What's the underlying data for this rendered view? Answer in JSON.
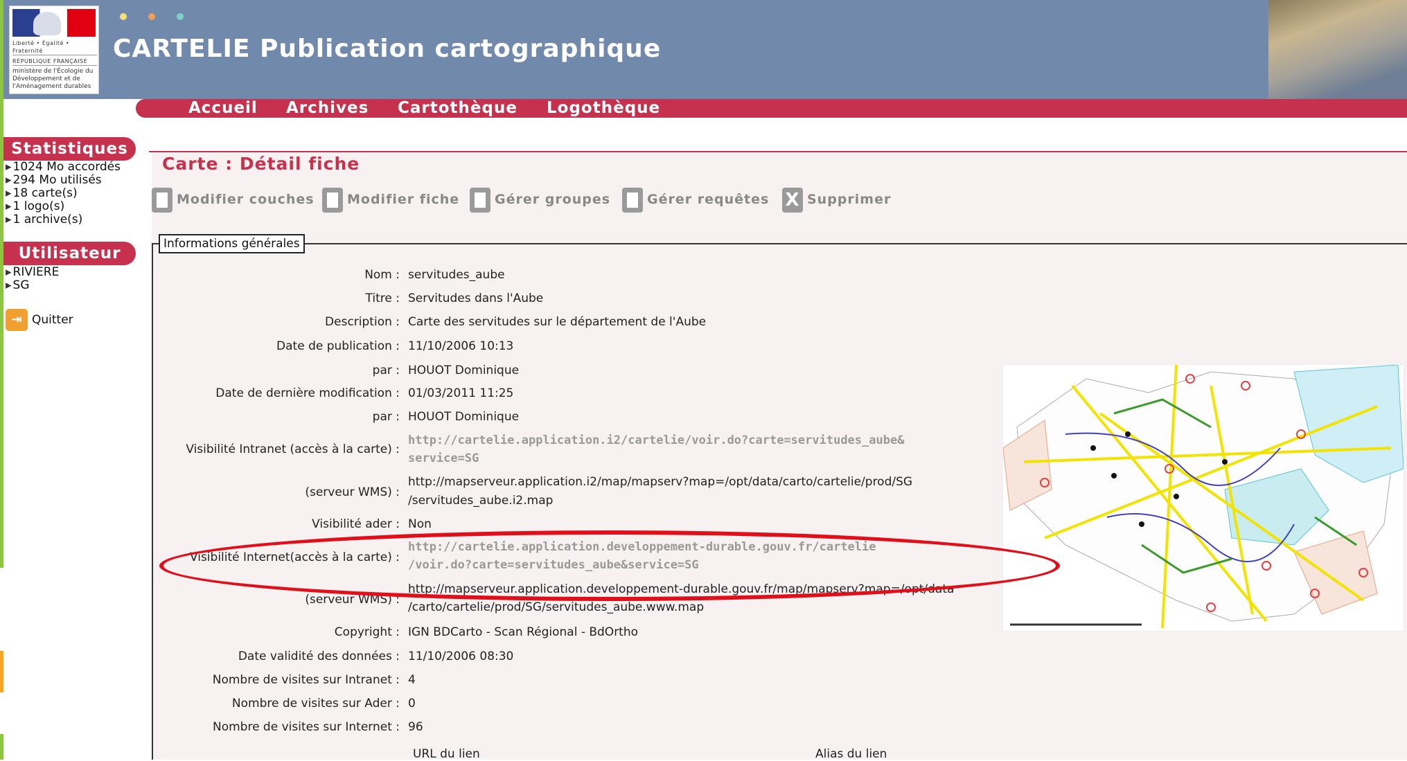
{
  "header": {
    "title": "CARTELIE Publication cartographique",
    "logo": {
      "motto": "Liberté • Égalité • Fraternité",
      "republic": "RÉPUBLIQUE FRANÇAISE",
      "ministry": "ministère de l'Écologie du Développement et de l'Aménagement durables"
    },
    "dot_colors": [
      "#f2e27a",
      "#f0a05a",
      "#7fd1c7"
    ]
  },
  "nav": {
    "items": [
      "Accueil",
      "Archives",
      "Cartothèque",
      "Logothèque"
    ]
  },
  "sidebar": {
    "stats_title": "Statistiques",
    "stats": [
      "1024 Mo accordés",
      "294 Mo utilisés",
      "18 carte(s)",
      "1 logo(s)",
      "1 archive(s)"
    ],
    "user_title": "Utilisateur",
    "user": [
      "RIVIERE",
      "SG"
    ],
    "quit_label": "Quitter"
  },
  "page": {
    "title": "Carte : Détail fiche",
    "toolbar": [
      "Modifier couches",
      "Modifier fiche",
      "Gérer groupes",
      "Gérer requêtes",
      "Supprimer"
    ],
    "legend": "Informations générales"
  },
  "fields": [
    {
      "label": "Nom :",
      "value": "servitudes_aube"
    },
    {
      "label": "Titre :",
      "value": "Servitudes dans l'Aube"
    },
    {
      "label": "Description :",
      "value": "Carte des servitudes sur le département de l'Aube"
    },
    {
      "label": "Date de publication :",
      "value": "11/10/2006 10:13"
    },
    {
      "label": "par :",
      "value": "HOUOT Dominique"
    },
    {
      "label": "Date de dernière modification :",
      "value": "01/03/2011 11:25"
    },
    {
      "label": "par :",
      "value": "HOUOT Dominique"
    },
    {
      "label": "Visibilité Intranet (accès à la carte) :",
      "value_line1": "http://cartelie.application.i2/cartelie/voir.do?carte=servitudes_aube&",
      "value_line2": "service=SG"
    },
    {
      "label": "(serveur WMS) :",
      "value_line1": "http://mapserveur.application.i2/map/mapserv?map=/opt/data/carto/cartelie/prod/SG",
      "value_line2": "/servitudes_aube.i2.map"
    },
    {
      "label": "Visibilité ader :",
      "value": "Non"
    },
    {
      "label": "Visibilité Internet(accès à la carte) :",
      "value_line1": "http://cartelie.application.developpement-durable.gouv.fr/cartelie",
      "value_line2": "/voir.do?carte=servitudes_aube&service=SG"
    },
    {
      "label": "(serveur WMS) :",
      "value_line1": "http://mapserveur.application.developpement-durable.gouv.fr/map/mapserv?map=/opt/data",
      "value_line2": "/carto/cartelie/prod/SG/servitudes_aube.www.map"
    },
    {
      "label": "Copyright :",
      "value": "IGN BDCarto - Scan Régional - BdOrtho"
    },
    {
      "label": "Date validité des données :",
      "value": "11/10/2006 08:30"
    },
    {
      "label": "Nombre de visites sur Intranet :",
      "value": "4"
    },
    {
      "label": "Nombre de visites sur Ader :",
      "value": "0"
    },
    {
      "label": "Nombre de visites sur Internet :",
      "value": "96"
    }
  ],
  "link_table": {
    "col_url": "URL du lien",
    "col_alias": "Alias du lien"
  },
  "colors": {
    "accent": "#c6324e",
    "header_bg": "#7189ab",
    "panel_bg": "#f8f1f2",
    "highlight": "#e0101a"
  }
}
